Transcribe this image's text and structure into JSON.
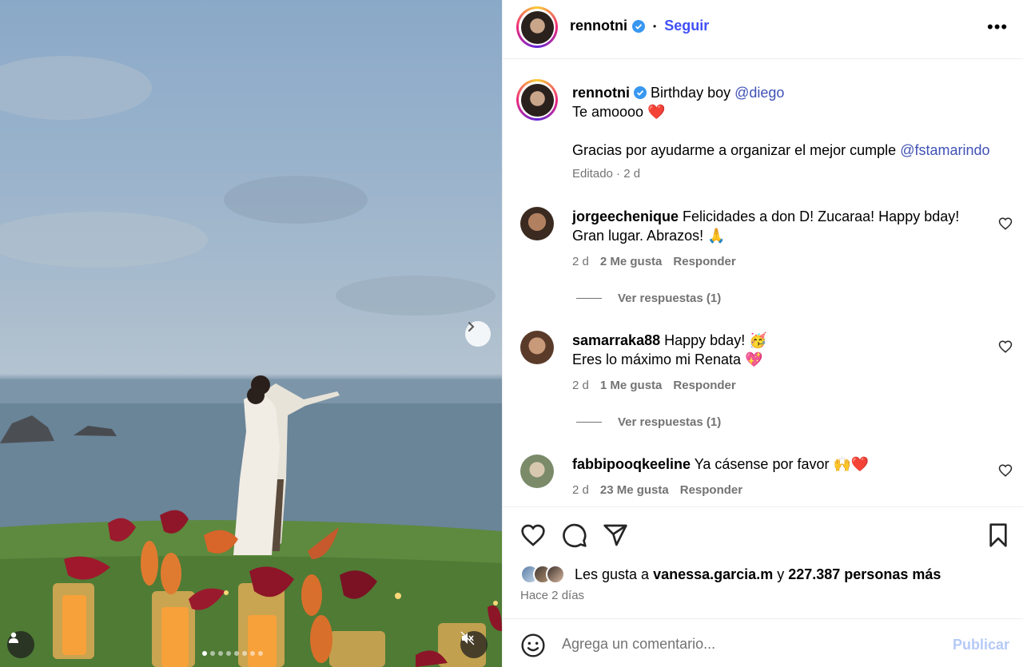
{
  "post": {
    "username": "rennotni",
    "follow_label": "Seguir",
    "dot_separator": "•",
    "more_label": "•••",
    "caption_user": "rennotni",
    "caption_line1_text": "Birthday boy",
    "caption_line1_mention": "@diego",
    "caption_line2": "Te amoooo ❤️",
    "caption_line3_text": "Gracias por ayudarme a organizar el mejor cumple",
    "caption_line3_mention": "@fstamarindo",
    "caption_meta": "Editado · 2 d"
  },
  "comments": [
    {
      "user": "jorgeechenique",
      "text_line1": "Felicidades a don D! Zucaraa! Happy bday!",
      "text_line2": "Gran lugar. Abrazos! 🙏",
      "time": "2 d",
      "likes": "2 Me gusta",
      "reply": "Responder",
      "view_replies": "Ver respuestas (1)"
    },
    {
      "user": "samarraka88",
      "text_line1": "Happy bday! 🥳",
      "text_line2": "Eres lo máximo mi Renata 💖",
      "time": "2 d",
      "likes": "1 Me gusta",
      "reply": "Responder",
      "view_replies": "Ver respuestas (1)"
    },
    {
      "user": "fabbipooqkeeline",
      "text_line1": "Ya cásense por favor 🙌❤️",
      "time": "2 d",
      "likes": "23 Me gusta",
      "reply": "Responder"
    }
  ],
  "engagement": {
    "likes_prefix": "Les gusta a",
    "likes_user": "vanessa.garcia.m",
    "likes_mid": "y",
    "likes_count": "227.387 personas más",
    "time_ago": "Hace 2 días"
  },
  "composer": {
    "placeholder": "Agrega un comentario...",
    "publish_label": "Publicar"
  },
  "carousel": {
    "slide_count": 8,
    "active_index": 0
  },
  "colors": {
    "link": "#3f51b5",
    "follow": "#4150f7",
    "verified": "#3897f0",
    "publish_disabled": "#b5c9f7"
  }
}
